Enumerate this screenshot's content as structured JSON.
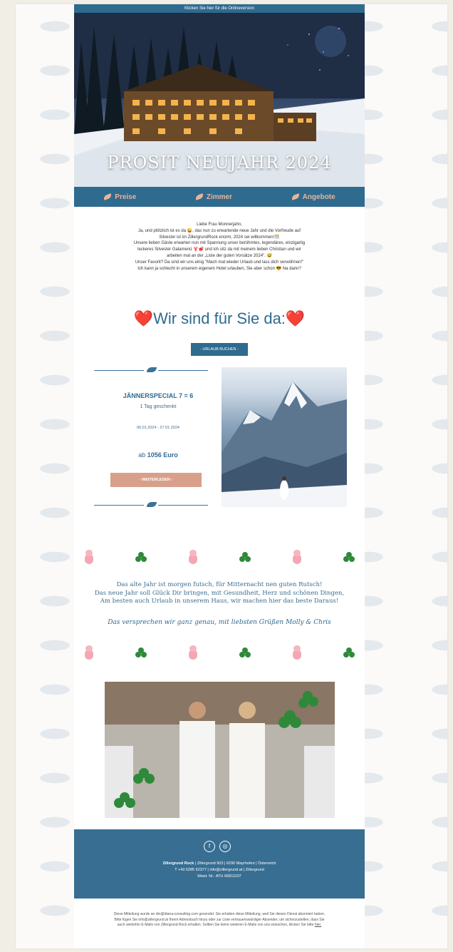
{
  "preheader": {
    "text": "Klicken Sie hier für die Onlineversion"
  },
  "hero": {
    "title": "PROSIT NEUJAHR 2024"
  },
  "nav": [
    {
      "label": "Preise",
      "icon": "bird-icon"
    },
    {
      "label": "Zimmer",
      "icon": "bird-icon"
    },
    {
      "label": "Angebote",
      "icon": "bird-icon"
    }
  ],
  "intro": {
    "lines": [
      "Liebe Frau Monnerjahn,",
      "Ja, und plötzlich ist es da 😜, das nun zu erwartende neue Jahr und die Vorfreude auf",
      "Silvester ist im ZillergrundRock enorm, 2024 sei willkommen!🎊",
      "Unsere lieben Gäste erwarten nun mit Spannung unser berühmtes, legendäres, einzigartig",
      "leckeres Silvester Galamenü 🦞🥩 und ich sitz da mit meinem lieben Christian und wir",
      "arbeiten mal an der „Liste der guten Vorsätze 2024\". 😅",
      "Unser Favorit? Da sind wir uns einig \"Mach mal wieder Urlaub und lass dich verwöhnen!\"",
      "Ich kann ja schlecht in unserem eigenem Hotel urlauben, Sie aber schon 😎 Na dann?"
    ]
  },
  "contact": {
    "heading_text": "Wir sind für Sie da:",
    "heart_char": "❤️",
    "button_label": "- URLAUB BUCHEN -"
  },
  "special": {
    "title": "JÄNNERSPECIAL 7 = 6",
    "subtitle": "1 Tag geschenkt",
    "dates": "06.01.2024 - 27.01.2024",
    "price_prefix": "ab",
    "price": "1056 Euro",
    "button_label": "- WEITERLESEN -"
  },
  "poem": {
    "lines": [
      "Das alte Jahr ist morgen futsch, für Mitternacht nen guten Rutsch!",
      "Das neue Jahr soll Glück Dir bringen, mit Gesundheit, Herz und schönen Dingen,",
      "Am besten auch Urlaub in unserem Haus, wir machen hier das beste Daraus!"
    ],
    "signature": "Das versprechen wir ganz genau, mit liebsten Grüßen Molly & Chris"
  },
  "footer": {
    "social": [
      {
        "icon": "facebook-icon",
        "glyph": "f"
      },
      {
        "icon": "instagram-icon",
        "glyph": "◎"
      }
    ],
    "company": "Zillergrund Rock",
    "address_line1_rest": " | Zillergrund 903 | 6290 Mayrhofen | Österreich",
    "address_line2": "T +43 5285 62377 | info@zillergrund.at | Zillergrund",
    "address_line3": "Mwst. Nr.: ATU 66811107",
    "note": "Diese Mitteilung wurde an dm@diana-consulting.com gesendet. Sie erhalten diese Mitteilung, weil Sie diesen Dienst abonniert haben. Bitte fügen Sie info@zillergrund.at Ihrem Adressbuch hinzu oder zur Liste vertrauenswürdiger Absender, um sicherzustellen, dass Sie auch weiterhin E-Mails von Zillergrund Rock erhalten. Sollten Sie keine weiteren E-Mails von uns wünschen, klicken Sie bitte",
    "unsubscribe_link": "hier."
  },
  "colors": {
    "brand_blue": "#2f6a8f",
    "salmon": "#d8a08a",
    "nav_text": "#e8b59a",
    "heart": "#e0302c"
  }
}
